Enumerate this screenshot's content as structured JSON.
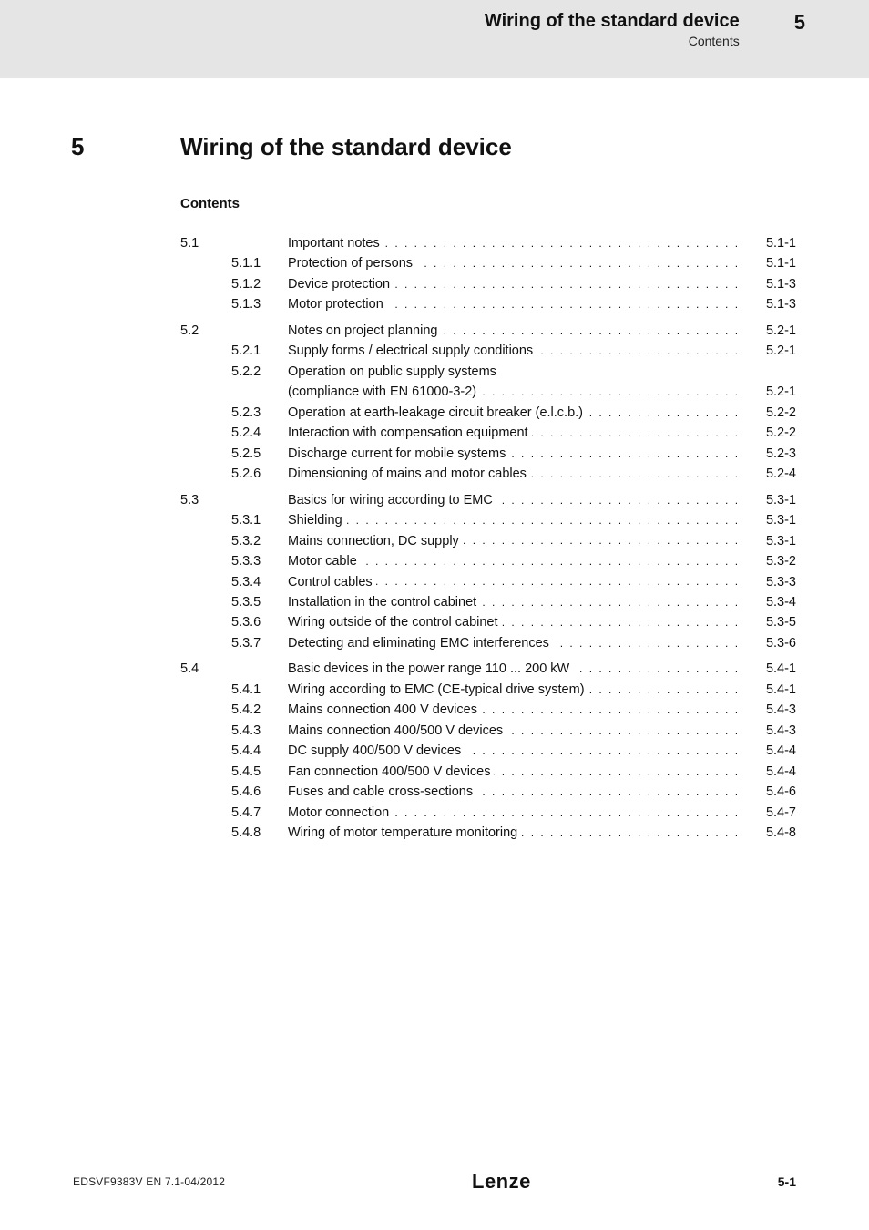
{
  "header": {
    "title": "Wiring of the standard device",
    "subtitle": "Contents",
    "pageno": "5"
  },
  "section": {
    "num": "5",
    "title": "Wiring of the standard device"
  },
  "contents_label": "Contents",
  "toc": [
    {
      "a": "5.1",
      "b": "",
      "t": "Important notes",
      "p": "5.1-1",
      "lvl": 1
    },
    {
      "a": "",
      "b": "5.1.1",
      "t": "Protection of persons",
      "p": "5.1-1",
      "lvl": 2
    },
    {
      "a": "",
      "b": "5.1.2",
      "t": "Device protection",
      "p": "5.1-3",
      "lvl": 2
    },
    {
      "a": "",
      "b": "5.1.3",
      "t": "Motor protection",
      "p": "5.1-3",
      "lvl": 2
    },
    {
      "a": "5.2",
      "b": "",
      "t": "Notes on project planning",
      "p": "5.2-1",
      "lvl": 1,
      "gap": true
    },
    {
      "a": "",
      "b": "5.2.1",
      "t": "Supply forms / electrical supply conditions",
      "p": "5.2-1",
      "lvl": 2
    },
    {
      "a": "",
      "b": "5.2.2",
      "t1": "Operation on public supply systems",
      "t2": "(compliance with EN 61000-3-2)",
      "p": "5.2-1",
      "lvl": 2,
      "multi": true
    },
    {
      "a": "",
      "b": "5.2.3",
      "t": "Operation at earth-leakage circuit breaker (e.l.c.b.)",
      "p": "5.2-2",
      "lvl": 2
    },
    {
      "a": "",
      "b": "5.2.4",
      "t": "Interaction with compensation equipment",
      "p": "5.2-2",
      "lvl": 2
    },
    {
      "a": "",
      "b": "5.2.5",
      "t": "Discharge current for mobile systems",
      "p": "5.2-3",
      "lvl": 2
    },
    {
      "a": "",
      "b": "5.2.6",
      "t": "Dimensioning of mains and motor cables",
      "p": "5.2-4",
      "lvl": 2
    },
    {
      "a": "5.3",
      "b": "",
      "t": "Basics for wiring according to EMC",
      "p": "5.3-1",
      "lvl": 1,
      "gap": true
    },
    {
      "a": "",
      "b": "5.3.1",
      "t": "Shielding",
      "p": "5.3-1",
      "lvl": 2
    },
    {
      "a": "",
      "b": "5.3.2",
      "t": "Mains connection, DC supply",
      "p": "5.3-1",
      "lvl": 2
    },
    {
      "a": "",
      "b": "5.3.3",
      "t": "Motor cable",
      "p": "5.3-2",
      "lvl": 2
    },
    {
      "a": "",
      "b": "5.3.4",
      "t": "Control cables",
      "p": "5.3-3",
      "lvl": 2
    },
    {
      "a": "",
      "b": "5.3.5",
      "t": "Installation in the control cabinet",
      "p": "5.3-4",
      "lvl": 2
    },
    {
      "a": "",
      "b": "5.3.6",
      "t": "Wiring outside of the control cabinet",
      "p": "5.3-5",
      "lvl": 2
    },
    {
      "a": "",
      "b": "5.3.7",
      "t": "Detecting and eliminating EMC interferences",
      "p": "5.3-6",
      "lvl": 2
    },
    {
      "a": "5.4",
      "b": "",
      "t": "Basic devices in the power range 110 ... 200 kW",
      "p": "5.4-1",
      "lvl": 1,
      "gap": true
    },
    {
      "a": "",
      "b": "5.4.1",
      "t": "Wiring according to EMC (CE-typical drive system)",
      "p": "5.4-1",
      "lvl": 2
    },
    {
      "a": "",
      "b": "5.4.2",
      "t": "Mains connection 400 V devices",
      "p": "5.4-3",
      "lvl": 2
    },
    {
      "a": "",
      "b": "5.4.3",
      "t": "Mains connection 400/500 V devices",
      "p": "5.4-3",
      "lvl": 2
    },
    {
      "a": "",
      "b": "5.4.4",
      "t": "DC supply 400/500 V devices",
      "p": "5.4-4",
      "lvl": 2
    },
    {
      "a": "",
      "b": "5.4.5",
      "t": "Fan connection 400/500 V devices",
      "p": "5.4-4",
      "lvl": 2
    },
    {
      "a": "",
      "b": "5.4.6",
      "t": "Fuses and cable cross-sections",
      "p": "5.4-6",
      "lvl": 2
    },
    {
      "a": "",
      "b": "5.4.7",
      "t": "Motor connection",
      "p": "5.4-7",
      "lvl": 2
    },
    {
      "a": "",
      "b": "5.4.8",
      "t": "Wiring of motor temperature monitoring",
      "p": "5.4-8",
      "lvl": 2
    }
  ],
  "footer": {
    "left": "EDSVF9383V EN 7.1-04/2012",
    "center": "Lenze",
    "right": "5-1"
  }
}
